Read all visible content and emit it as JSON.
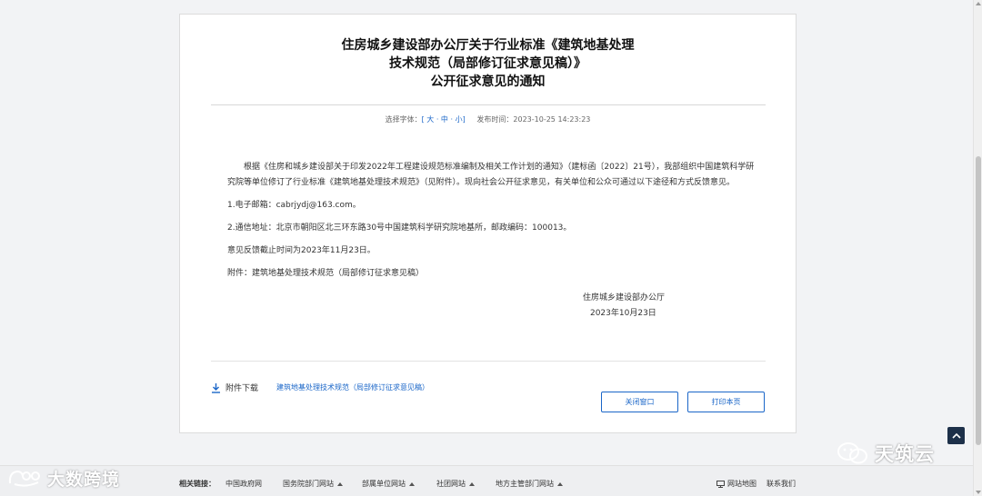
{
  "title_lines": [
    "住房城乡建设部办公厅关于行业标准《建筑地基处理",
    "技术规范（局部修订征求意见稿）》",
    "公开征求意见的通知"
  ],
  "meta": {
    "font_label": "选择字体：",
    "bracket_open": "[",
    "font_large": "大",
    "dot1": "·",
    "font_medium": "中",
    "dot2": "·",
    "font_small": "小",
    "bracket_close": "]",
    "publish_label": "发布时间：",
    "publish_time": "2023-10-25 14:23:23"
  },
  "body": {
    "paragraph": "根据《住房和城乡建设部关于印发2022年工程建设规范标准编制及相关工作计划的通知》（建标函〔2022〕21号），我部组织中国建筑科学研究院等单位修订了行业标准《建筑地基处理技术规范》（见附件）。现向社会公开征求意见，有关单位和公众可通过以下途径和方式反馈意见。",
    "email": "1.电子邮箱：cabrjydj@163.com。",
    "address": "2.通信地址：北京市朝阳区北三环东路30号中国建筑科学研究院地基所，邮政编码：100013。",
    "deadline": "意见反馈截止时间为2023年11月23日。",
    "attachment": "附件：建筑地基处理技术规范（局部修订征求意见稿）"
  },
  "signature": {
    "org": "住房城乡建设部办公厅",
    "date": "2023年10月23日"
  },
  "download": {
    "label": "附件下载",
    "link": "建筑地基处理技术规范（局部修订征求意见稿）"
  },
  "buttons": {
    "close": "关闭窗口",
    "print": "打印本页"
  },
  "footer": {
    "label": "相关链接：",
    "links": [
      "中国政府网",
      "国务院部门网站",
      "部属单位网站",
      "社团网站",
      "地方主管部门网站"
    ],
    "sitemap": "网站地图",
    "contact": "联系我们"
  },
  "watermarks": {
    "left": "大数跨境",
    "right": "天筑云"
  },
  "colors": {
    "link_blue": "#1a66c8",
    "to_top_bg": "#1d3049"
  }
}
